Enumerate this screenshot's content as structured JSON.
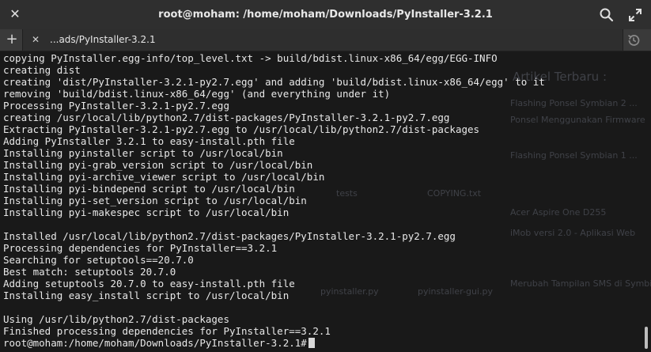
{
  "window": {
    "title": "root@moham: /home/moham/Downloads/PyInstaller-3.2.1",
    "close_glyph": "✕",
    "close_icon": "close-icon",
    "search_icon": "search-icon",
    "maximize_icon": "maximize-icon"
  },
  "tabs": {
    "add_glyph": "+",
    "add_icon": "plus-icon",
    "history_icon": "history-icon",
    "items": [
      {
        "label": "...ads/PyInstaller-3.2.1",
        "close_glyph": "✕"
      }
    ]
  },
  "terminal": {
    "lines": [
      "copying PyInstaller.egg-info/top_level.txt -> build/bdist.linux-x86_64/egg/EGG-INFO",
      "creating dist",
      "creating 'dist/PyInstaller-3.2.1-py2.7.egg' and adding 'build/bdist.linux-x86_64/egg' to it",
      "removing 'build/bdist.linux-x86_64/egg' (and everything under it)",
      "Processing PyInstaller-3.2.1-py2.7.egg",
      "creating /usr/local/lib/python2.7/dist-packages/PyInstaller-3.2.1-py2.7.egg",
      "Extracting PyInstaller-3.2.1-py2.7.egg to /usr/local/lib/python2.7/dist-packages",
      "Adding PyInstaller 3.2.1 to easy-install.pth file",
      "Installing pyinstaller script to /usr/local/bin",
      "Installing pyi-grab_version script to /usr/local/bin",
      "Installing pyi-archive_viewer script to /usr/local/bin",
      "Installing pyi-bindepend script to /usr/local/bin",
      "Installing pyi-set_version script to /usr/local/bin",
      "Installing pyi-makespec script to /usr/local/bin",
      "",
      "Installed /usr/local/lib/python2.7/dist-packages/PyInstaller-3.2.1-py2.7.egg",
      "Processing dependencies for PyInstaller==3.2.1",
      "Searching for setuptools==20.7.0",
      "Best match: setuptools 20.7.0",
      "Adding setuptools 20.7.0 to easy-install.pth file",
      "Installing easy_install script to /usr/local/bin",
      "",
      "Using /usr/lib/python2.7/dist-packages",
      "Finished processing dependencies for PyInstaller==3.2.1"
    ],
    "prompt": "root@moham:/home/moham/Downloads/PyInstaller-3.2.1#"
  },
  "colors": {
    "terminal_fg": "#e8e8e8",
    "titlebar_bg": "#2f2f2f",
    "tabbar_bg": "#3a3a3a"
  }
}
